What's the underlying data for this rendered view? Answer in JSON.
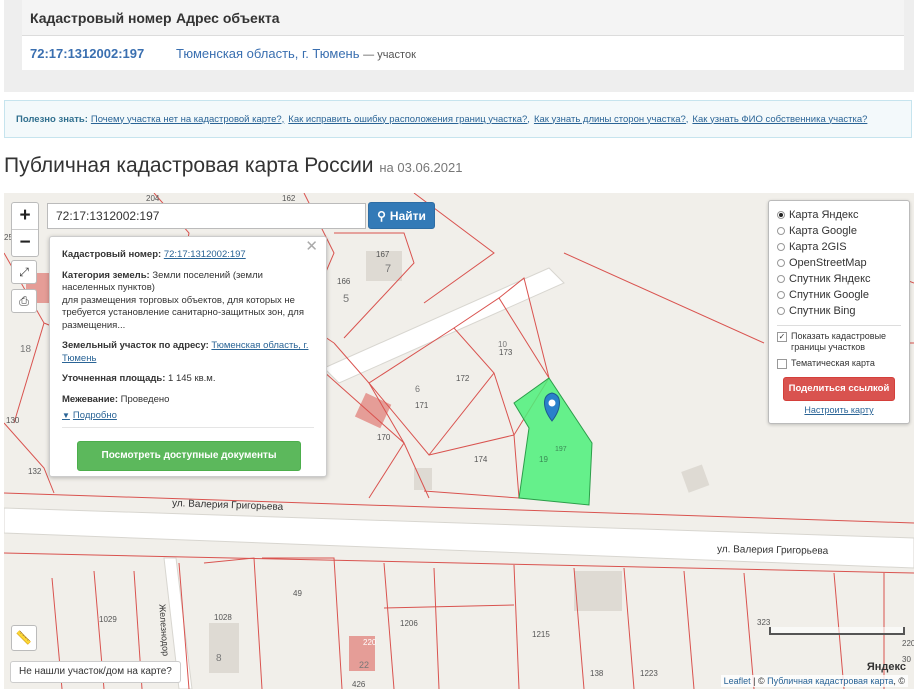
{
  "result_table": {
    "col_number": "Кадастровый номер",
    "col_address": "Адрес объекта",
    "row": {
      "number": "72:17:1312002:197",
      "address": "Тюменская область, г. Тюмень",
      "kind": "— участок"
    }
  },
  "useful": {
    "label": "Полезно знать:",
    "links": [
      "Почему участка нет на кадастровой карте?,",
      "Как исправить ошибку расположения границ участка?,",
      "Как узнать длины сторон участка?,",
      "Как узнать ФИО собственника участка?"
    ]
  },
  "title": {
    "main": "Публичная кадастровая карта России",
    "date": "на 03.06.2021"
  },
  "map": {
    "search_value": "72:17:1312002:197",
    "search_button": "Найти",
    "popup": {
      "cad_label": "Кадастровый номер:",
      "cad_value": "72:17:1312002:197",
      "cat_label": "Категория земель:",
      "cat_value": "Земли поселений (земли населенных пунктов)",
      "cat_extra": "для размещения торговых объектов, для которых не требуется установление санитарно-защитных зон, для размещения...",
      "addr_label": "Земельный участок по адресу:",
      "addr_value": "Тюменская область, г. Тюмень",
      "area_label": "Уточненная площадь:",
      "area_value": "1 145 кв.м.",
      "survey_label": "Межевание:",
      "survey_value": "Проведено",
      "more": "Подробно",
      "docs_button": "Посмотреть доступные документы"
    },
    "layers": {
      "options": [
        "Карта Яндекс",
        "Карта Google",
        "Карта 2GIS",
        "OpenStreetMap",
        "Спутник Яндекс",
        "Спутник Google",
        "Спутник Bing"
      ],
      "selected": "Карта Яндекс",
      "checkbox_borders": "Показать кадастровые границы участков",
      "checkbox_borders_checked": true,
      "checkbox_thematic": "Тематическая карта",
      "checkbox_thematic_checked": false,
      "share": "Поделиться ссылкой",
      "setup": "Настроить карту"
    },
    "street_labels": [
      "ул. Валерия Григорьева",
      "ул. Валерия Григорьева",
      "Железнодор"
    ],
    "parcel_labels": [
      "204",
      "162",
      "25",
      "167",
      "7",
      "166",
      "5",
      "18",
      "10",
      "173",
      "172",
      "6",
      "171",
      "170",
      "130",
      "174",
      "19",
      "132",
      "1029",
      "1028",
      "49",
      "8",
      "1206",
      "1215",
      "323",
      "138",
      "1223",
      "426",
      "22",
      "220",
      "220",
      "30",
      "197"
    ],
    "not_found": "Не нашли участок/дом на карте?",
    "attribution_leaflet": "Leaflet",
    "attribution_sep": " | © ",
    "attribution_pkk": "Публичная кадастровая карта",
    "attribution_tail": ", ©",
    "yandex_logo": "Яндекс",
    "highlight_color": "#4cf07a",
    "border_color": "#d9534f"
  }
}
